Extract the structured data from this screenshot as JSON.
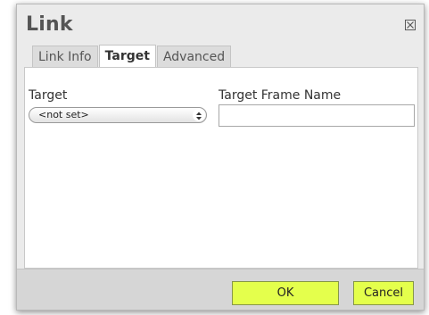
{
  "dialog": {
    "title": "Link",
    "close_icon": "close-icon",
    "tabs": [
      {
        "label": "Link Info",
        "active": false
      },
      {
        "label": "Target",
        "active": true
      },
      {
        "label": "Advanced",
        "active": false
      }
    ],
    "target": {
      "label": "Target",
      "selected": "<not set>"
    },
    "target_frame_name": {
      "label": "Target Frame Name",
      "value": ""
    },
    "buttons": {
      "ok_label": "OK",
      "cancel_label": "Cancel"
    },
    "colors": {
      "button_accent": "#e4ff4c",
      "background": "#ebebeb"
    }
  }
}
